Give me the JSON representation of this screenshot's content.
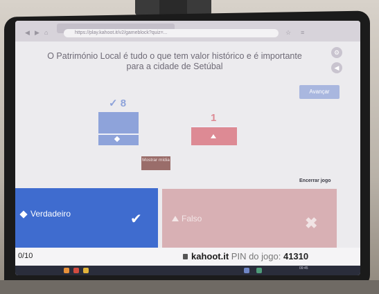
{
  "browser": {
    "url": "https://play.kahoot.it/v2/gameblock?quiz=..."
  },
  "question": "O Património Local é tudo o que tem valor histórico e é importante para a cidade de Setúbal",
  "advance_label": "Avançar",
  "results": {
    "true_count": "✓ 8",
    "false_count": "1"
  },
  "media_label": "Mostrar mídia",
  "end_game_label": "Encerrar jogo",
  "answers": {
    "true_label": "Verdadeiro",
    "false_label": "Falso"
  },
  "footer": {
    "progress": "0/10",
    "site": "kahoot.it",
    "pin_label": "PIN do jogo:",
    "pin_value": "41310"
  },
  "taskbar": {
    "time": "09:45"
  },
  "colors": {
    "true": "#3f6ccf",
    "false": "#d8b0b4",
    "bezel": "#1b1b1b"
  }
}
